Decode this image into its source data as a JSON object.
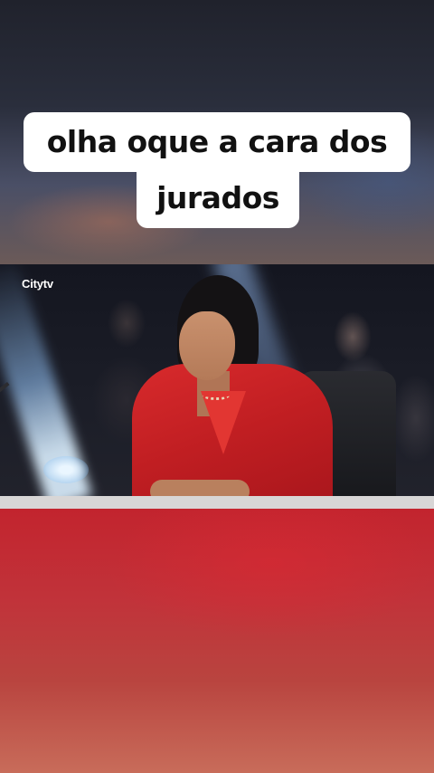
{
  "caption": {
    "line1": "olha oque a cara dos",
    "line2": "jurados"
  },
  "video": {
    "watermark": "Citytv"
  },
  "colors": {
    "caption_bg": "#ffffff",
    "caption_text": "#111111",
    "jacket_red": "#c01e22"
  }
}
